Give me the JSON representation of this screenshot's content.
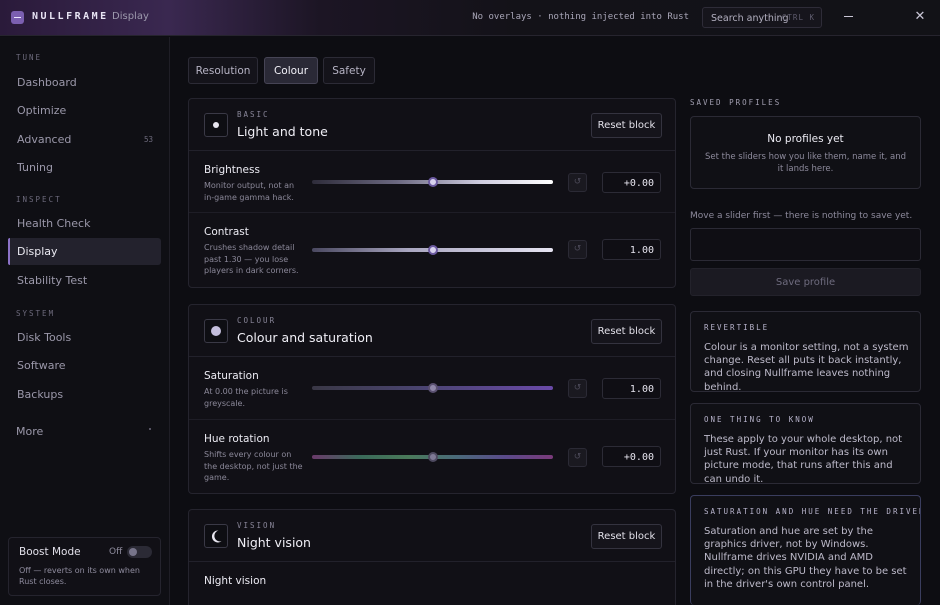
{
  "titlebar": {
    "brand": "NULLFRAME",
    "section": "Display",
    "status": "No overlays · nothing injected into Rust",
    "search_label": "Search anything",
    "search_shortcut": "CTRL K",
    "minimize_icon": "minimize-icon",
    "close_icon": "close-icon"
  },
  "sidebar": {
    "groups": [
      {
        "label": "TUNE",
        "items": [
          {
            "label": "Dashboard"
          },
          {
            "label": "Optimize"
          },
          {
            "label": "Advanced",
            "badge": "53"
          },
          {
            "label": "Tuning"
          }
        ]
      },
      {
        "label": "INSPECT",
        "items": [
          {
            "label": "Health Check"
          },
          {
            "label": "Display",
            "active": true
          },
          {
            "label": "Stability Test"
          }
        ]
      },
      {
        "label": "SYSTEM",
        "items": [
          {
            "label": "Disk Tools"
          },
          {
            "label": "Software"
          },
          {
            "label": "Backups"
          }
        ]
      }
    ],
    "more": "More",
    "boost": {
      "title": "Boost Mode",
      "state": "Off",
      "note": "Off — reverts on its own when Rust closes."
    }
  },
  "tabs": [
    {
      "label": "Resolution"
    },
    {
      "label": "Colour",
      "active": true
    },
    {
      "label": "Safety"
    }
  ],
  "blocks": [
    {
      "eyebrow": "BASIC",
      "title": "Light and tone",
      "reset": "Reset block",
      "icon": "brightness-icon",
      "rows": [
        {
          "label": "Brightness",
          "desc": "Monitor output, not an in-game gamma hack.",
          "value": "+0.00",
          "position": 0.5
        },
        {
          "label": "Contrast",
          "desc": "Crushes shadow detail past 1.30 — you lose players in dark corners.",
          "value": "1.00",
          "position": 0.5
        }
      ]
    },
    {
      "eyebrow": "COLOUR",
      "title": "Colour and saturation",
      "reset": "Reset block",
      "icon": "colour-dot-icon",
      "rows": [
        {
          "label": "Saturation",
          "desc": "At 0.00 the picture is greyscale.",
          "value": "1.00",
          "position": 0.5
        },
        {
          "label": "Hue rotation",
          "desc": "Shifts every colour on the desktop, not just the game.",
          "value": "+0.00",
          "position": 0.5
        }
      ]
    },
    {
      "eyebrow": "VISION",
      "title": "Night vision",
      "reset": "Reset block",
      "icon": "moon-icon",
      "rows": [
        {
          "label": "Night vision",
          "desc": ""
        }
      ]
    }
  ],
  "profiles": {
    "label": "SAVED PROFILES",
    "empty_title": "No profiles yet",
    "empty_desc": "Set the sliders how you like them, name it, and it lands here.",
    "hint": "Move a slider first — there is nothing to save yet.",
    "name_value": "",
    "save": "Save profile"
  },
  "notes": [
    {
      "title": "REVERTIBLE",
      "body": "Colour is a monitor setting, not a system change. Reset all puts it back instantly, and closing Nullframe leaves nothing behind."
    },
    {
      "title": "ONE THING TO KNOW",
      "body": "These apply to your whole desktop, not just Rust. If your monitor has its own picture mode, that runs after this and can undo it."
    },
    {
      "title": "SATURATION AND HUE NEED THE DRIVER",
      "body": "Saturation and hue are set by the graphics driver, not by Windows. Nullframe drives NVIDIA and AMD directly; on this GPU they have to be set in the driver's own control panel."
    }
  ],
  "colors": {
    "accent": "#8c72c8",
    "background": "#0d0d12",
    "panel": "#111016"
  }
}
